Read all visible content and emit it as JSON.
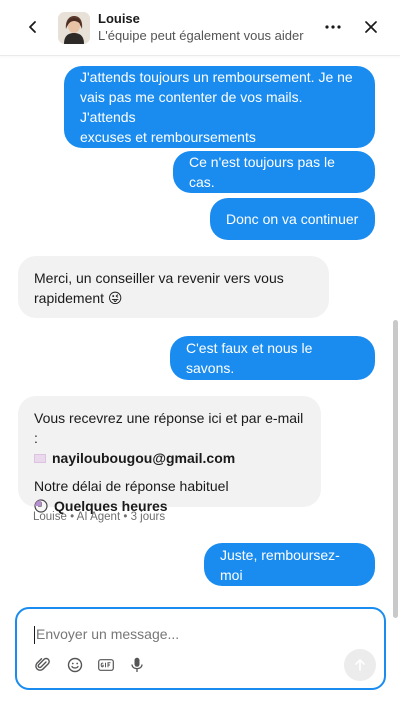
{
  "header": {
    "agent_name": "Louise",
    "subtitle": "L'équipe peut également vous aider",
    "icons": [
      "chevron-left-icon",
      "more-horizontal-icon",
      "close-icon"
    ]
  },
  "messages": {
    "out_1": [
      "J'attends toujours un remboursement. Je ne",
      "vais pas me contenter de vos mails. J'attends",
      "excuses et remboursements"
    ],
    "out_2": "Ce n'est toujours pas le cas.",
    "out_3": "Donc on va continuer",
    "in_1": [
      "Merci, un conseiller va revenir vers vous",
      "rapidement 😜"
    ],
    "out_4": "C'est faux et nous le savons.",
    "in_2": {
      "line1": "Vous recevrez une réponse ici et par e-mail :",
      "email": "nayiloubougou@gmail.com",
      "line2": "Notre délai de réponse habituel",
      "delay": "Quelques heures"
    },
    "in_2_meta": "Louise • AI Agent • 3 jours",
    "out_5": "Juste, remboursez-moi"
  },
  "composer": {
    "placeholder": "Envoyer un message...",
    "tools": [
      "paperclip-icon",
      "emoji-icon",
      "gif-icon",
      "microphone-icon"
    ],
    "send_icon": "arrow-up-icon"
  },
  "colors": {
    "accent": "#1a8cf0",
    "incoming_bubble": "#f2f2f3"
  }
}
